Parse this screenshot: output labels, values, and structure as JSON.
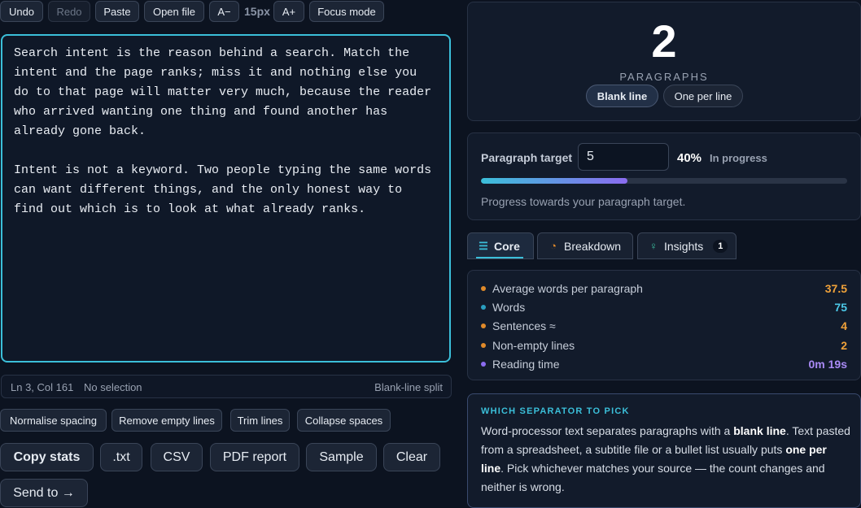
{
  "toolbar": {
    "undo": "Undo",
    "redo": "Redo",
    "paste": "Paste",
    "open_file": "Open file",
    "font_down": "A−",
    "font_size": "15px",
    "font_up": "A+",
    "focus_mode": "Focus mode"
  },
  "editor": {
    "text": "Search intent is the reason behind a search. Match the intent and the page ranks; miss it and nothing else you do to that page will matter very much, because the reader who arrived wanting one thing and found another has already gone back.\n\nIntent is not a keyword. Two people typing the same words can want different things, and the only honest way to find out which is to look at what already ranks."
  },
  "status": {
    "position": "Ln 3, Col 161",
    "selection": "No selection",
    "mode": "Blank-line split"
  },
  "clean_tools": [
    "Normalise spacing",
    "Remove empty lines",
    "Trim lines",
    "Collapse spaces"
  ],
  "actions": {
    "copy_stats": "Copy stats",
    "txt": ".txt",
    "csv": "CSV",
    "pdf": "PDF report",
    "sample": "Sample",
    "clear": "Clear",
    "send_to": "Send to →"
  },
  "count": {
    "value": "2",
    "label": "PARAGRAPHS",
    "mode_blank": "Blank line",
    "mode_one": "One per line"
  },
  "target": {
    "label": "Paragraph target",
    "value": "5",
    "percent_text": "40%",
    "progress_fraction": 0.4,
    "status": "In progress",
    "help": "Progress towards your paragraph target."
  },
  "tabs": {
    "core": "Core",
    "breakdown": "Breakdown",
    "insights": "Insights",
    "insights_badge": "1"
  },
  "stats": [
    {
      "label": "Average words per paragraph",
      "value": "37.5",
      "color": "#f0a23a",
      "dot": "#e08a2a"
    },
    {
      "label": "Words",
      "value": "75",
      "color": "#4cc9e8",
      "dot": "#2a9fc0"
    },
    {
      "label": "Sentences ≈",
      "value": "4",
      "color": "#f0a23a",
      "dot": "#e08a2a"
    },
    {
      "label": "Non-empty lines",
      "value": "2",
      "color": "#f0a23a",
      "dot": "#e08a2a"
    },
    {
      "label": "Reading time",
      "value": "0m 19s",
      "color": "#a98af5",
      "dot": "#8b6cf0"
    }
  ],
  "tip": {
    "heading": "WHICH SEPARATOR TO PICK",
    "p1": "Word-processor text separates paragraphs with a ",
    "b1": "blank line",
    "p2": ". Text pasted from a spreadsheet, a subtitle file or a bullet list usually puts ",
    "b2": "one per line",
    "p3": ". Pick whichever matches your source — the count changes and neither is wrong."
  }
}
